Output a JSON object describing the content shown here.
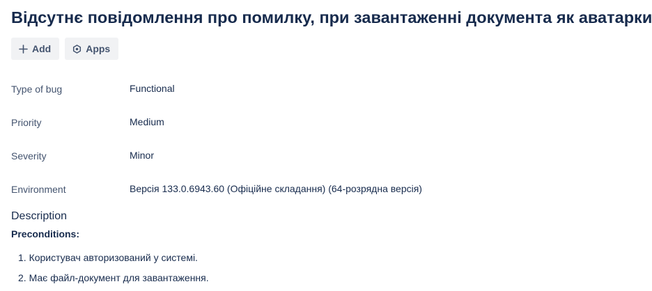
{
  "issue": {
    "title": "Відсутнє повідомлення про помилку, при завантаженні документа як аватарки."
  },
  "toolbar": {
    "add_label": "Add",
    "apps_label": "Apps"
  },
  "fields": [
    {
      "label": "Type of bug",
      "value": "Functional"
    },
    {
      "label": "Priority",
      "value": "Medium"
    },
    {
      "label": "Severity",
      "value": "Minor"
    },
    {
      "label": "Environment",
      "value": "Версія 133.0.6943.60 (Офіційне складання) (64-розрядна версія)"
    }
  ],
  "description": {
    "heading": "Description",
    "preconditions_label": "Preconditions:",
    "steps": [
      "1. Користувач авторизований у системі.",
      "2. Має файл-документ для завантаження."
    ]
  }
}
